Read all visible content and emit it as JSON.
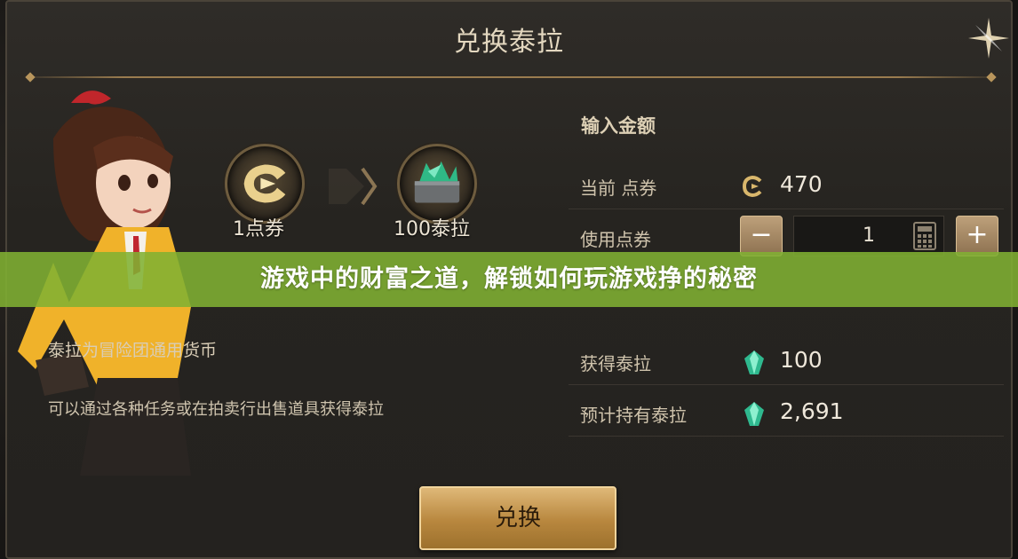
{
  "dialog": {
    "title": "兑换泰拉",
    "close_icon": "close-star-icon"
  },
  "exchange": {
    "from_label": "1点券",
    "to_label": "100泰拉",
    "from_icon": "point-coupon-icon",
    "to_icon": "tera-chest-icon",
    "arrow_icon": "chevron-right-icon"
  },
  "description": {
    "line1": "泰拉为冒险团通用货币",
    "line2": "可以通过各种任务或在拍卖行出售道具获得泰拉"
  },
  "panel": {
    "section_title": "输入金额",
    "current_label": "当前 点券",
    "current_value": "470",
    "use_label": "使用点券",
    "use_value": "1",
    "obtain_label": "获得泰拉",
    "obtain_value": "100",
    "expected_label": "预计持有泰拉",
    "expected_value": "2,691",
    "minus_label": "−",
    "plus_label": "+"
  },
  "confirm": {
    "label": "兑换"
  },
  "banner": {
    "text": "游戏中的财富之道，解锁如何玩游戏挣的秘密"
  },
  "colors": {
    "accent_gold": "#c49a55",
    "banner_green": "#81b132",
    "gem_teal": "#3fd3b0"
  }
}
